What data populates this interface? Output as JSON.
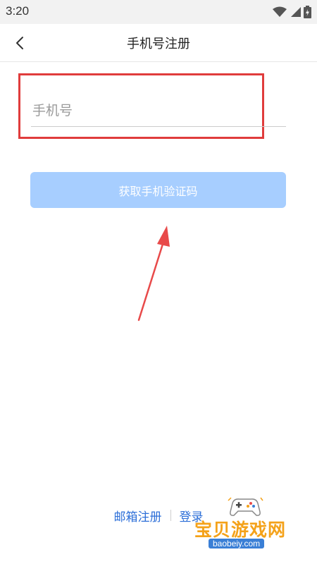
{
  "status_bar": {
    "time": "3:20",
    "icons": [
      "wifi-icon",
      "signal-icon",
      "battery-icon"
    ]
  },
  "header": {
    "back_icon": "chevron-left-icon",
    "title": "手机号注册"
  },
  "form": {
    "phone_placeholder": "手机号",
    "phone_value": "",
    "get_code_label": "获取手机验证码"
  },
  "annotations": {
    "highlight_color": "#e03c3c",
    "arrow_color": "#e84a4a"
  },
  "footer": {
    "email_register_label": "邮箱注册",
    "login_label": "登录"
  },
  "watermark": {
    "name": "宝贝游戏网",
    "url": "baobeiy.com"
  },
  "colors": {
    "primary_disabled": "#a7ceff",
    "link": "#2d6fd8"
  }
}
